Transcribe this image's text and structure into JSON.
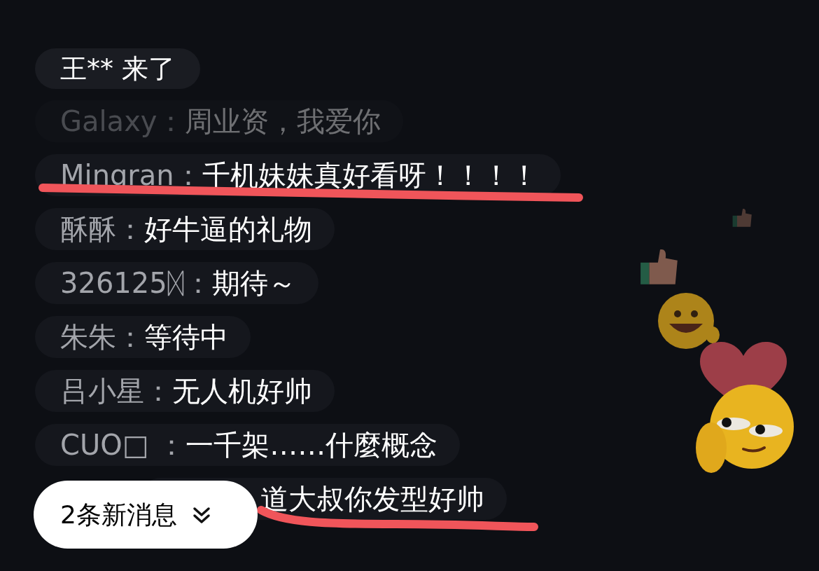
{
  "messages": [
    {
      "kind": "entry",
      "text": "王** 来了",
      "faded": false
    },
    {
      "kind": "chat",
      "name": "Galaxy：",
      "text": "周业资，我爱你",
      "faded": true
    },
    {
      "kind": "chat",
      "name": "Mingran：",
      "text": "千机妹妹真好看呀！！！！",
      "faded": false
    },
    {
      "kind": "chat",
      "name": "酥酥：",
      "text": "好牛逼的礼物",
      "faded": false
    },
    {
      "kind": "chat",
      "name": "326125ᛞ：",
      "text": "期待～",
      "faded": false
    },
    {
      "kind": "chat",
      "name": "朱朱：",
      "text": "等待中",
      "faded": false
    },
    {
      "kind": "chat",
      "name": "吕小星：",
      "text": "无人机好帅",
      "faded": false
    },
    {
      "kind": "chat",
      "name": "CUO□ ：",
      "text": "一千架……什麼概念",
      "faded": false
    },
    {
      "kind": "tail",
      "text": "道大叔你发型好帅",
      "faded": false
    }
  ],
  "new_messages_button": {
    "label": "2条新消息"
  }
}
